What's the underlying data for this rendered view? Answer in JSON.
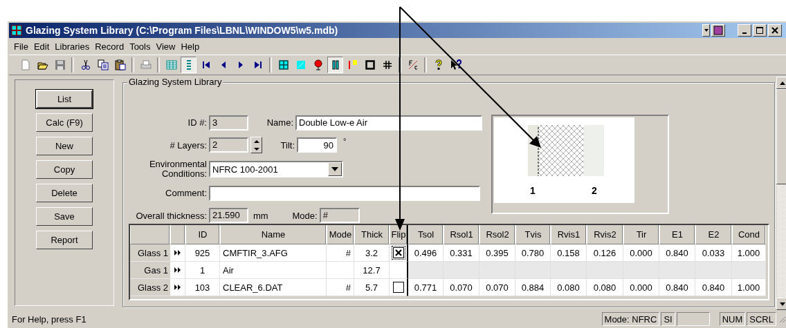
{
  "window": {
    "title": "Glazing System Library (C:\\Program Files\\LBNL\\WINDOW5\\w5.mdb)"
  },
  "menu": [
    "File",
    "Edit",
    "Libraries",
    "Record",
    "Tools",
    "View",
    "Help"
  ],
  "toolbar": [
    {
      "kind": "new",
      "pressed": false
    },
    {
      "kind": "open",
      "pressed": false
    },
    {
      "kind": "save",
      "pressed": false
    },
    {
      "kind": "separator"
    },
    {
      "kind": "cut",
      "pressed": false
    },
    {
      "kind": "copy",
      "pressed": false
    },
    {
      "kind": "paste",
      "pressed": false
    },
    {
      "kind": "separator"
    },
    {
      "kind": "print",
      "pressed": false
    },
    {
      "kind": "separator"
    },
    {
      "kind": "grid",
      "pressed": false
    },
    {
      "kind": "list",
      "pressed": true
    },
    {
      "kind": "first",
      "pressed": false
    },
    {
      "kind": "prev",
      "pressed": false
    },
    {
      "kind": "next",
      "pressed": false
    },
    {
      "kind": "last",
      "pressed": false
    },
    {
      "kind": "separator"
    },
    {
      "kind": "window",
      "pressed": false
    },
    {
      "kind": "glass",
      "pressed": false
    },
    {
      "kind": "balloon",
      "pressed": false
    },
    {
      "kind": "bars",
      "pressed": true
    },
    {
      "kind": "thermo",
      "pressed": false
    },
    {
      "kind": "frame",
      "pressed": false
    },
    {
      "kind": "hash",
      "pressed": false
    },
    {
      "kind": "separator"
    },
    {
      "kind": "units",
      "pressed": false
    },
    {
      "kind": "separator"
    },
    {
      "kind": "help",
      "pressed": false
    },
    {
      "kind": "whatsthis",
      "pressed": false
    }
  ],
  "side_buttons": [
    {
      "label": "List",
      "default": true
    },
    {
      "label": "Calc (F9)",
      "default": false
    },
    {
      "label": "New",
      "default": false
    },
    {
      "label": "Copy",
      "default": false
    },
    {
      "label": "Delete",
      "default": false
    },
    {
      "label": "Save",
      "default": false
    },
    {
      "label": "Report",
      "default": false
    }
  ],
  "group_title": "Glazing System Library",
  "form": {
    "id_label": "ID #:",
    "id": "3",
    "name_label": "Name:",
    "name": "Double Low-e Air",
    "layers_label": "# Layers:",
    "layers": "2",
    "tilt_label": "Tilt:",
    "tilt": "90",
    "tilt_unit": "°",
    "env_label": "Environmental Conditions:",
    "env": "NFRC 100-2001",
    "comment_label": "Comment:",
    "thickness_label": "Overall thickness:",
    "thickness": "21.590",
    "thickness_unit": "mm",
    "mode_label": "Mode:",
    "mode": "#"
  },
  "diagram": {
    "labels": [
      "1",
      "2"
    ]
  },
  "table": {
    "columns": [
      "ID",
      "Name",
      "Mode",
      "Thick",
      "Flip",
      "Tsol",
      "Rsol1",
      "Rsol2",
      "Tvis",
      "Rvis1",
      "Rvis2",
      "Tir",
      "E1",
      "E2",
      "Cond"
    ],
    "rows": [
      {
        "kind": "glass",
        "label": "Glass 1",
        "id": "925",
        "name": "CMFTIR_3.AFG",
        "mode": "#",
        "thick": "3.2",
        "flip": true,
        "values": [
          "0.496",
          "0.331",
          "0.395",
          "0.780",
          "0.158",
          "0.126",
          "0.000",
          "0.840",
          "0.033",
          "1.000"
        ]
      },
      {
        "kind": "gas",
        "label": "Gas 1",
        "id": "1",
        "name": "Air",
        "thick": "12.7"
      },
      {
        "kind": "glass",
        "label": "Glass 2",
        "id": "103",
        "name": "CLEAR_6.DAT",
        "mode": "#",
        "thick": "5.7",
        "flip": false,
        "values": [
          "0.771",
          "0.070",
          "0.070",
          "0.884",
          "0.080",
          "0.080",
          "0.000",
          "0.840",
          "0.840",
          "1.000"
        ]
      }
    ]
  },
  "status_bar": {
    "help": "For Help, press F1",
    "panes": [
      "Mode: NFRC",
      "SI",
      "NUM",
      "SCRL"
    ]
  }
}
